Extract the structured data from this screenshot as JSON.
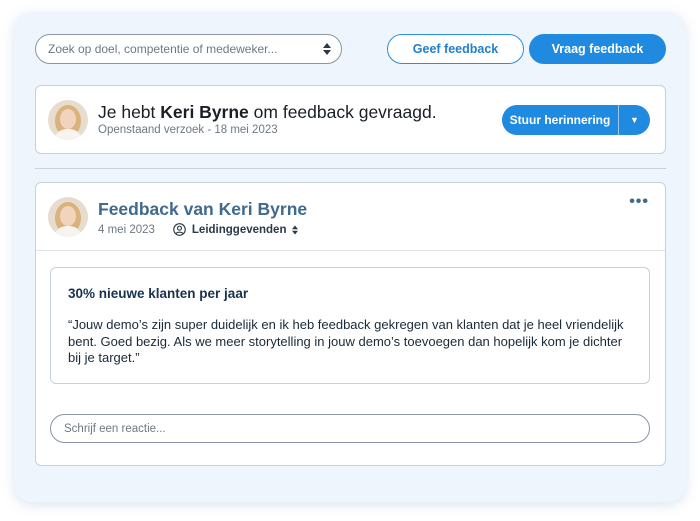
{
  "search": {
    "placeholder": "Zoek op doel, competentie of medeweker..."
  },
  "toolbar": {
    "give_label": "Geef feedback",
    "ask_label": "Vraag feedback"
  },
  "request": {
    "prefix": "Je hebt ",
    "name": "Keri Byrne",
    "suffix": " om feedback gevraagd.",
    "subtitle": "Openstaand verzoek - 18 mei 2023",
    "remind_label": "Stuur herinnering"
  },
  "feedback": {
    "title": "Feedback van Keri Byrne",
    "date": "4 mei 2023",
    "audience": "Leidinggevenden",
    "goal_title": "30% nieuwe klanten per jaar",
    "goal_text": "“Jouw demo’s zijn super duidelijk en ik heb feedback gekregen van klanten dat je heel vriendelijk bent. Goed bezig. Als we meer storytelling in jouw demo’s toevoegen dan hopelijk kom je dichter bij je target.”",
    "comment_placeholder": "Schrijf een reactie..."
  },
  "colors": {
    "primary": "#1f8ae0",
    "title_blue": "#3f6a8e",
    "panel_bg": "#eef5fc"
  },
  "icons": [
    "sort-icon",
    "caret-down-icon",
    "person-icon",
    "more-icon",
    "avatar"
  ]
}
